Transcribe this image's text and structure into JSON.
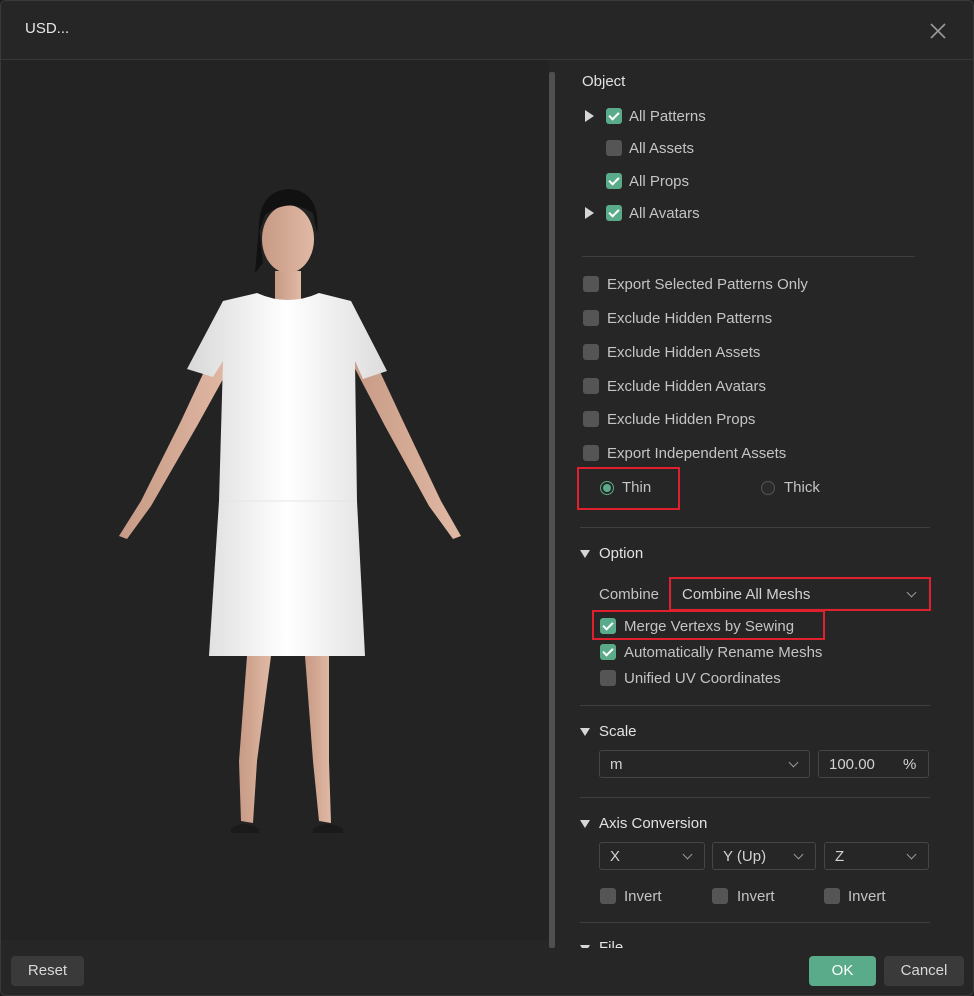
{
  "dialog": {
    "title": "USD..."
  },
  "object_section": {
    "header": "Object",
    "items": [
      {
        "label": "All Patterns",
        "checked": true,
        "expandable": true
      },
      {
        "label": "All Assets",
        "checked": false,
        "expandable": false
      },
      {
        "label": "All Props",
        "checked": true,
        "expandable": false
      },
      {
        "label": "All Avatars",
        "checked": true,
        "expandable": true
      }
    ]
  },
  "export_options": [
    {
      "label": "Export Selected Patterns Only",
      "checked": false
    },
    {
      "label": "Exclude Hidden Patterns",
      "checked": false
    },
    {
      "label": "Exclude Hidden Assets",
      "checked": false
    },
    {
      "label": "Exclude Hidden Avatars",
      "checked": false
    },
    {
      "label": "Exclude Hidden Props",
      "checked": false
    },
    {
      "label": "Export Independent Assets",
      "checked": false
    }
  ],
  "thickness": {
    "thin_label": "Thin",
    "thick_label": "Thick",
    "selected": "Thin"
  },
  "option_section": {
    "header": "Option",
    "combine_label": "Combine",
    "combine_value": "Combine All Meshs",
    "checks": [
      {
        "label": "Merge Vertexs by Sewing",
        "checked": true
      },
      {
        "label": "Automatically Rename Meshs",
        "checked": true
      },
      {
        "label": "Unified UV Coordinates",
        "checked": false
      }
    ]
  },
  "scale_section": {
    "header": "Scale",
    "unit": "m",
    "value": "100.00",
    "percent": "%"
  },
  "axis_section": {
    "header": "Axis Conversion",
    "axes": [
      {
        "value": "X",
        "invert_label": "Invert",
        "invert": false
      },
      {
        "value": "Y (Up)",
        "invert_label": "Invert",
        "invert": false
      },
      {
        "value": "Z",
        "invert_label": "Invert",
        "invert": false
      }
    ]
  },
  "file_section": {
    "header": "File"
  },
  "footer": {
    "reset": "Reset",
    "ok": "OK",
    "cancel": "Cancel"
  },
  "colors": {
    "accent": "#5aab8a",
    "highlight": "#e0212d",
    "background": "#262626"
  }
}
